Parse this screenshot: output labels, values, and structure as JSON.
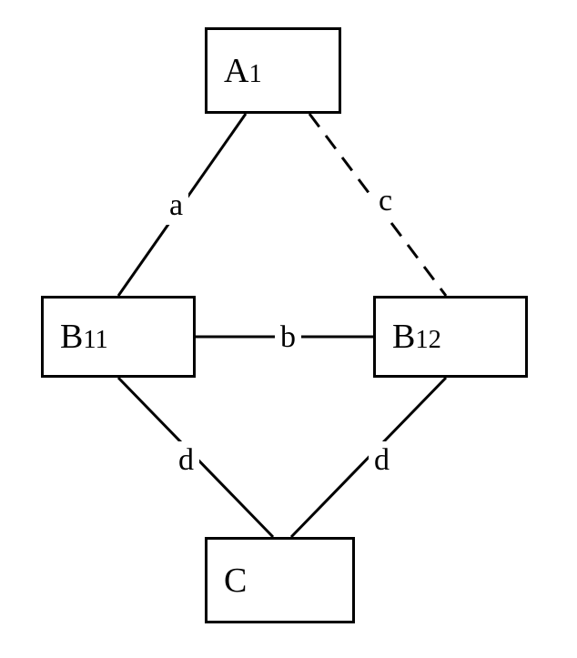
{
  "nodes": {
    "a1": {
      "label": "A",
      "sub": "1"
    },
    "b11": {
      "label": "B",
      "sub": "11"
    },
    "b12": {
      "label": "B",
      "sub": "12"
    },
    "c": {
      "label": "C"
    }
  },
  "edges": {
    "a": "a",
    "b": "b",
    "c": "c",
    "d1": "d",
    "d2": "d"
  },
  "chart_data": {
    "type": "diagram",
    "nodes": [
      "A1",
      "B11",
      "B12",
      "C"
    ],
    "edges": [
      {
        "from": "A1",
        "to": "B11",
        "label": "a",
        "style": "solid"
      },
      {
        "from": "B11",
        "to": "B12",
        "label": "b",
        "style": "solid"
      },
      {
        "from": "A1",
        "to": "B12",
        "label": "c",
        "style": "dashed"
      },
      {
        "from": "B11",
        "to": "C",
        "label": "d",
        "style": "solid"
      },
      {
        "from": "B12",
        "to": "C",
        "label": "d",
        "style": "solid"
      }
    ]
  }
}
